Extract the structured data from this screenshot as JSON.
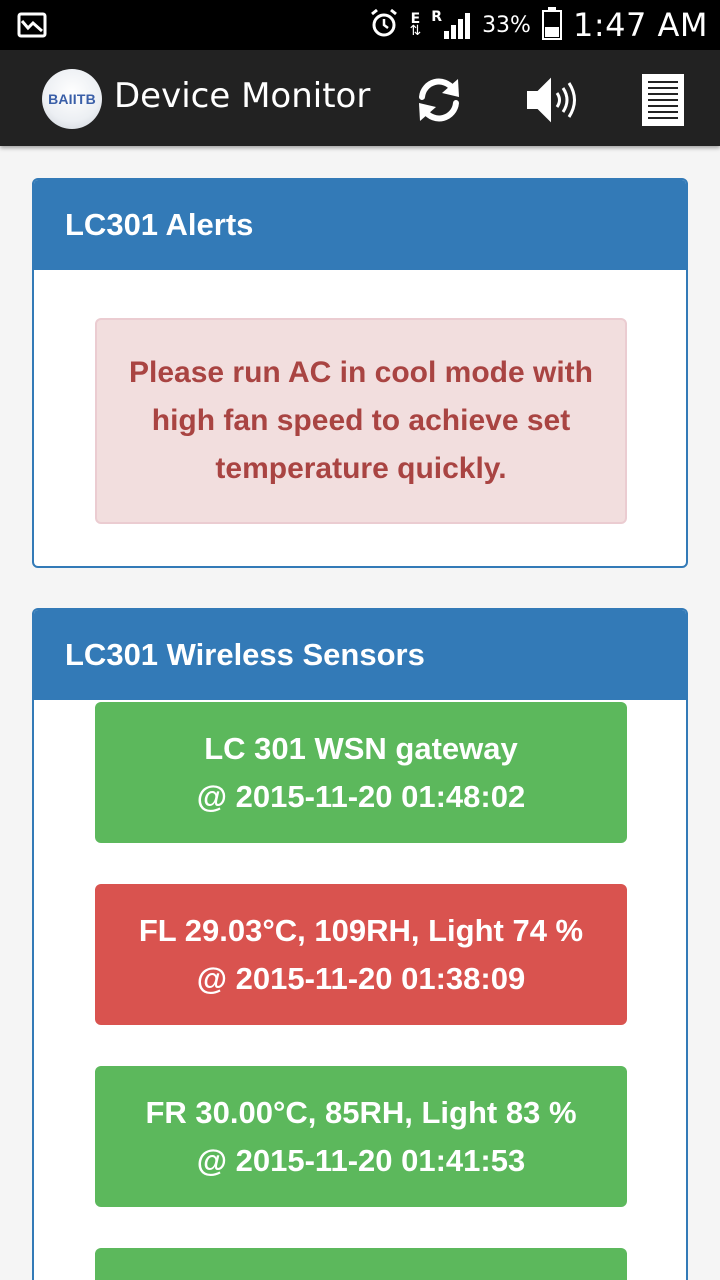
{
  "status_bar": {
    "battery_percent": "33%",
    "time": "1:47 AM",
    "network_labels": [
      "E",
      "R"
    ],
    "icons": [
      "gallery-notification-icon",
      "alarm-icon",
      "signal-icon",
      "battery-icon"
    ]
  },
  "app_bar": {
    "logo_text": "BAIITB",
    "title": "Device Monitor",
    "icons": [
      "refresh-icon",
      "speaker-icon",
      "list-icon"
    ]
  },
  "alerts_panel": {
    "heading": "LC301 Alerts",
    "message": "Please run AC in cool mode with high fan speed to achieve set temperature quickly."
  },
  "sensors_panel": {
    "heading": "LC301 Wireless Sensors",
    "items": [
      {
        "line1": "LC 301 WSN gateway",
        "line2": "@ 2015-11-20 01:48:02",
        "status": "ok"
      },
      {
        "line1": "FL 29.03°C, 109RH, Light 74 %",
        "line2": "@ 2015-11-20 01:38:09",
        "status": "alert"
      },
      {
        "line1": "FR 30.00°C, 85RH, Light 83 %",
        "line2": "@ 2015-11-20 01:41:53",
        "status": "ok"
      }
    ]
  },
  "colors": {
    "panel_primary": "#337ab7",
    "success": "#5cb85c",
    "danger": "#d9534f",
    "alert_bg": "#f2dede",
    "alert_text": "#a94442",
    "app_bar": "#222222"
  }
}
